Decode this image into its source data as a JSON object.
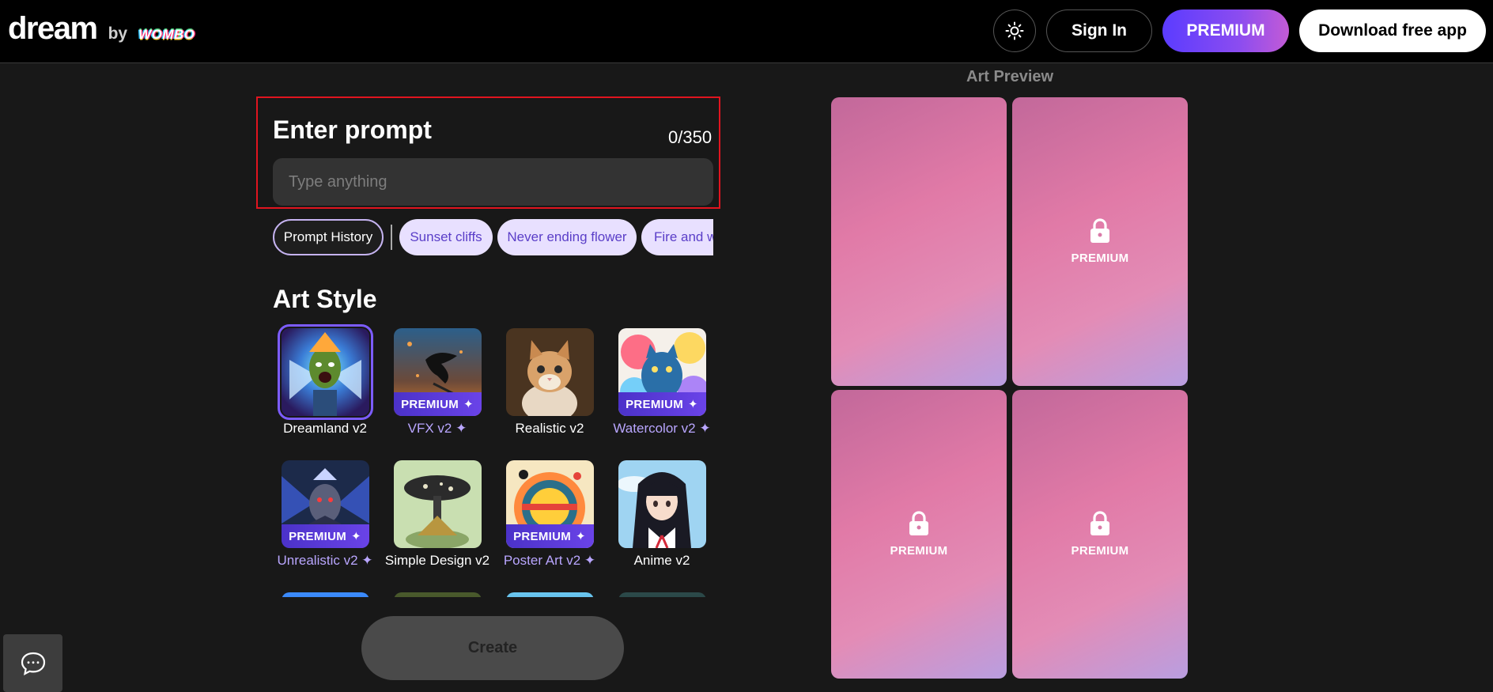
{
  "header": {
    "logo_text": "dream",
    "logo_by": "by",
    "logo_brand": "WOMBO",
    "theme_icon": "sun-icon",
    "signin_label": "Sign In",
    "premium_label": "PREMIUM",
    "download_label": "Download free app"
  },
  "prompt": {
    "title": "Enter prompt",
    "counter": "0/350",
    "placeholder": "Type anything",
    "value": ""
  },
  "chips": {
    "history_label": "Prompt History",
    "suggestions": [
      "Sunset cliffs",
      "Never ending flower",
      "Fire and water"
    ]
  },
  "art_style": {
    "title": "Art Style",
    "badge_label": "PREMIUM",
    "items": [
      {
        "label": "Dreamland v2",
        "premium": false,
        "selected": true
      },
      {
        "label": "VFX v2 ✦",
        "premium": true,
        "selected": false
      },
      {
        "label": "Realistic v2",
        "premium": false,
        "selected": false
      },
      {
        "label": "Watercolor v2 ✦",
        "premium": true,
        "selected": false
      },
      {
        "label": "Unrealistic v2 ✦",
        "premium": true,
        "selected": false
      },
      {
        "label": "Simple Design v2",
        "premium": false,
        "selected": false
      },
      {
        "label": "Poster Art v2 ✦",
        "premium": true,
        "selected": false
      },
      {
        "label": "Anime v2",
        "premium": false,
        "selected": false
      }
    ]
  },
  "create_label": "Create",
  "preview": {
    "title": "Art Preview",
    "locked_label": "PREMIUM",
    "lock_icon": "lock-icon"
  },
  "colors": {
    "accent": "#7c5cff",
    "highlight_border": "#e0141f",
    "chip_bg": "#e8e0ff",
    "chip_text": "#5a3ec8"
  }
}
